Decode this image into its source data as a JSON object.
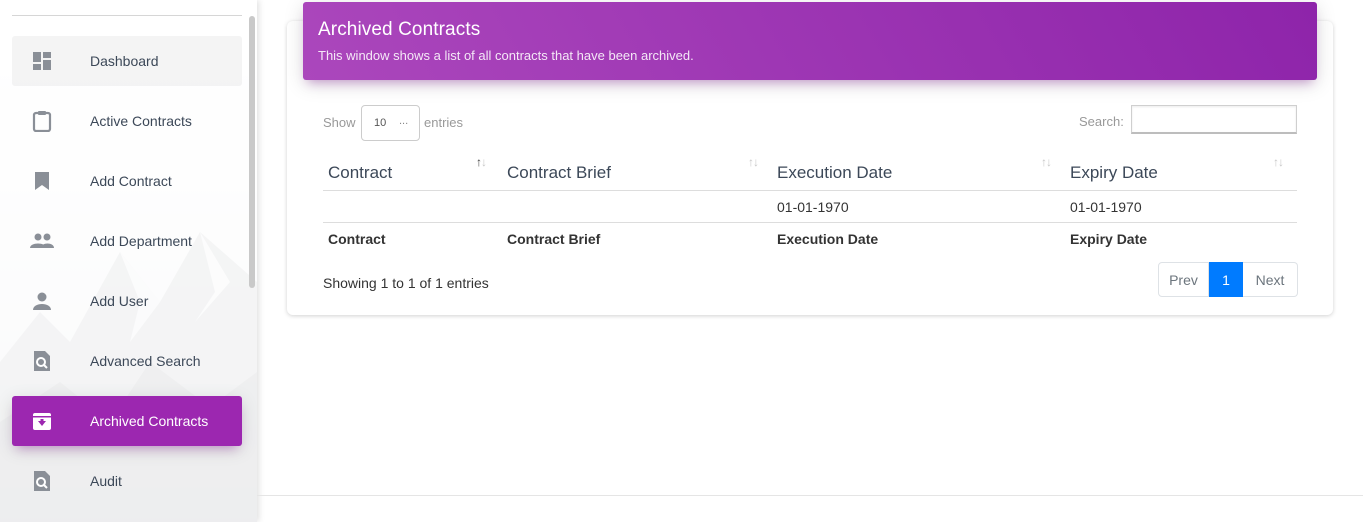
{
  "sidebar": {
    "items": [
      {
        "label": "Dashboard",
        "icon": "dashboard-icon"
      },
      {
        "label": "Active Contracts",
        "icon": "clipboard-icon"
      },
      {
        "label": "Add Contract",
        "icon": "bookmark-icon"
      },
      {
        "label": "Add Department",
        "icon": "people-icon"
      },
      {
        "label": "Add User",
        "icon": "person-icon"
      },
      {
        "label": "Advanced Search",
        "icon": "search-document-icon"
      },
      {
        "label": "Archived Contracts",
        "icon": "archive-icon",
        "active": true
      },
      {
        "label": "Audit",
        "icon": "search-document-icon"
      }
    ],
    "active_color": "#9c27b0"
  },
  "card": {
    "title": "Archived Contracts",
    "subtitle": "This window shows a list of all contracts that have been archived.",
    "header_color": "#9c27b0"
  },
  "table_controls": {
    "show_label": "Show",
    "entries_label": "entries",
    "length_value": "10",
    "length_dots": "...",
    "search_label": "Search:",
    "search_value": ""
  },
  "table": {
    "columns": [
      "Contract",
      "Contract Brief",
      "Execution Date",
      "Expiry Date"
    ],
    "sorted_column": "Contract",
    "rows": [
      {
        "contract": "",
        "brief": "",
        "execution_date": "01-01-1970",
        "expiry_date": "01-01-1970"
      }
    ],
    "footer": [
      "Contract",
      "Contract Brief",
      "Execution Date",
      "Expiry Date"
    ]
  },
  "info": "Showing 1 to 1 of 1 entries",
  "pagination": {
    "prev": "Prev",
    "current": "1",
    "next": "Next",
    "active_color": "#007bff"
  }
}
